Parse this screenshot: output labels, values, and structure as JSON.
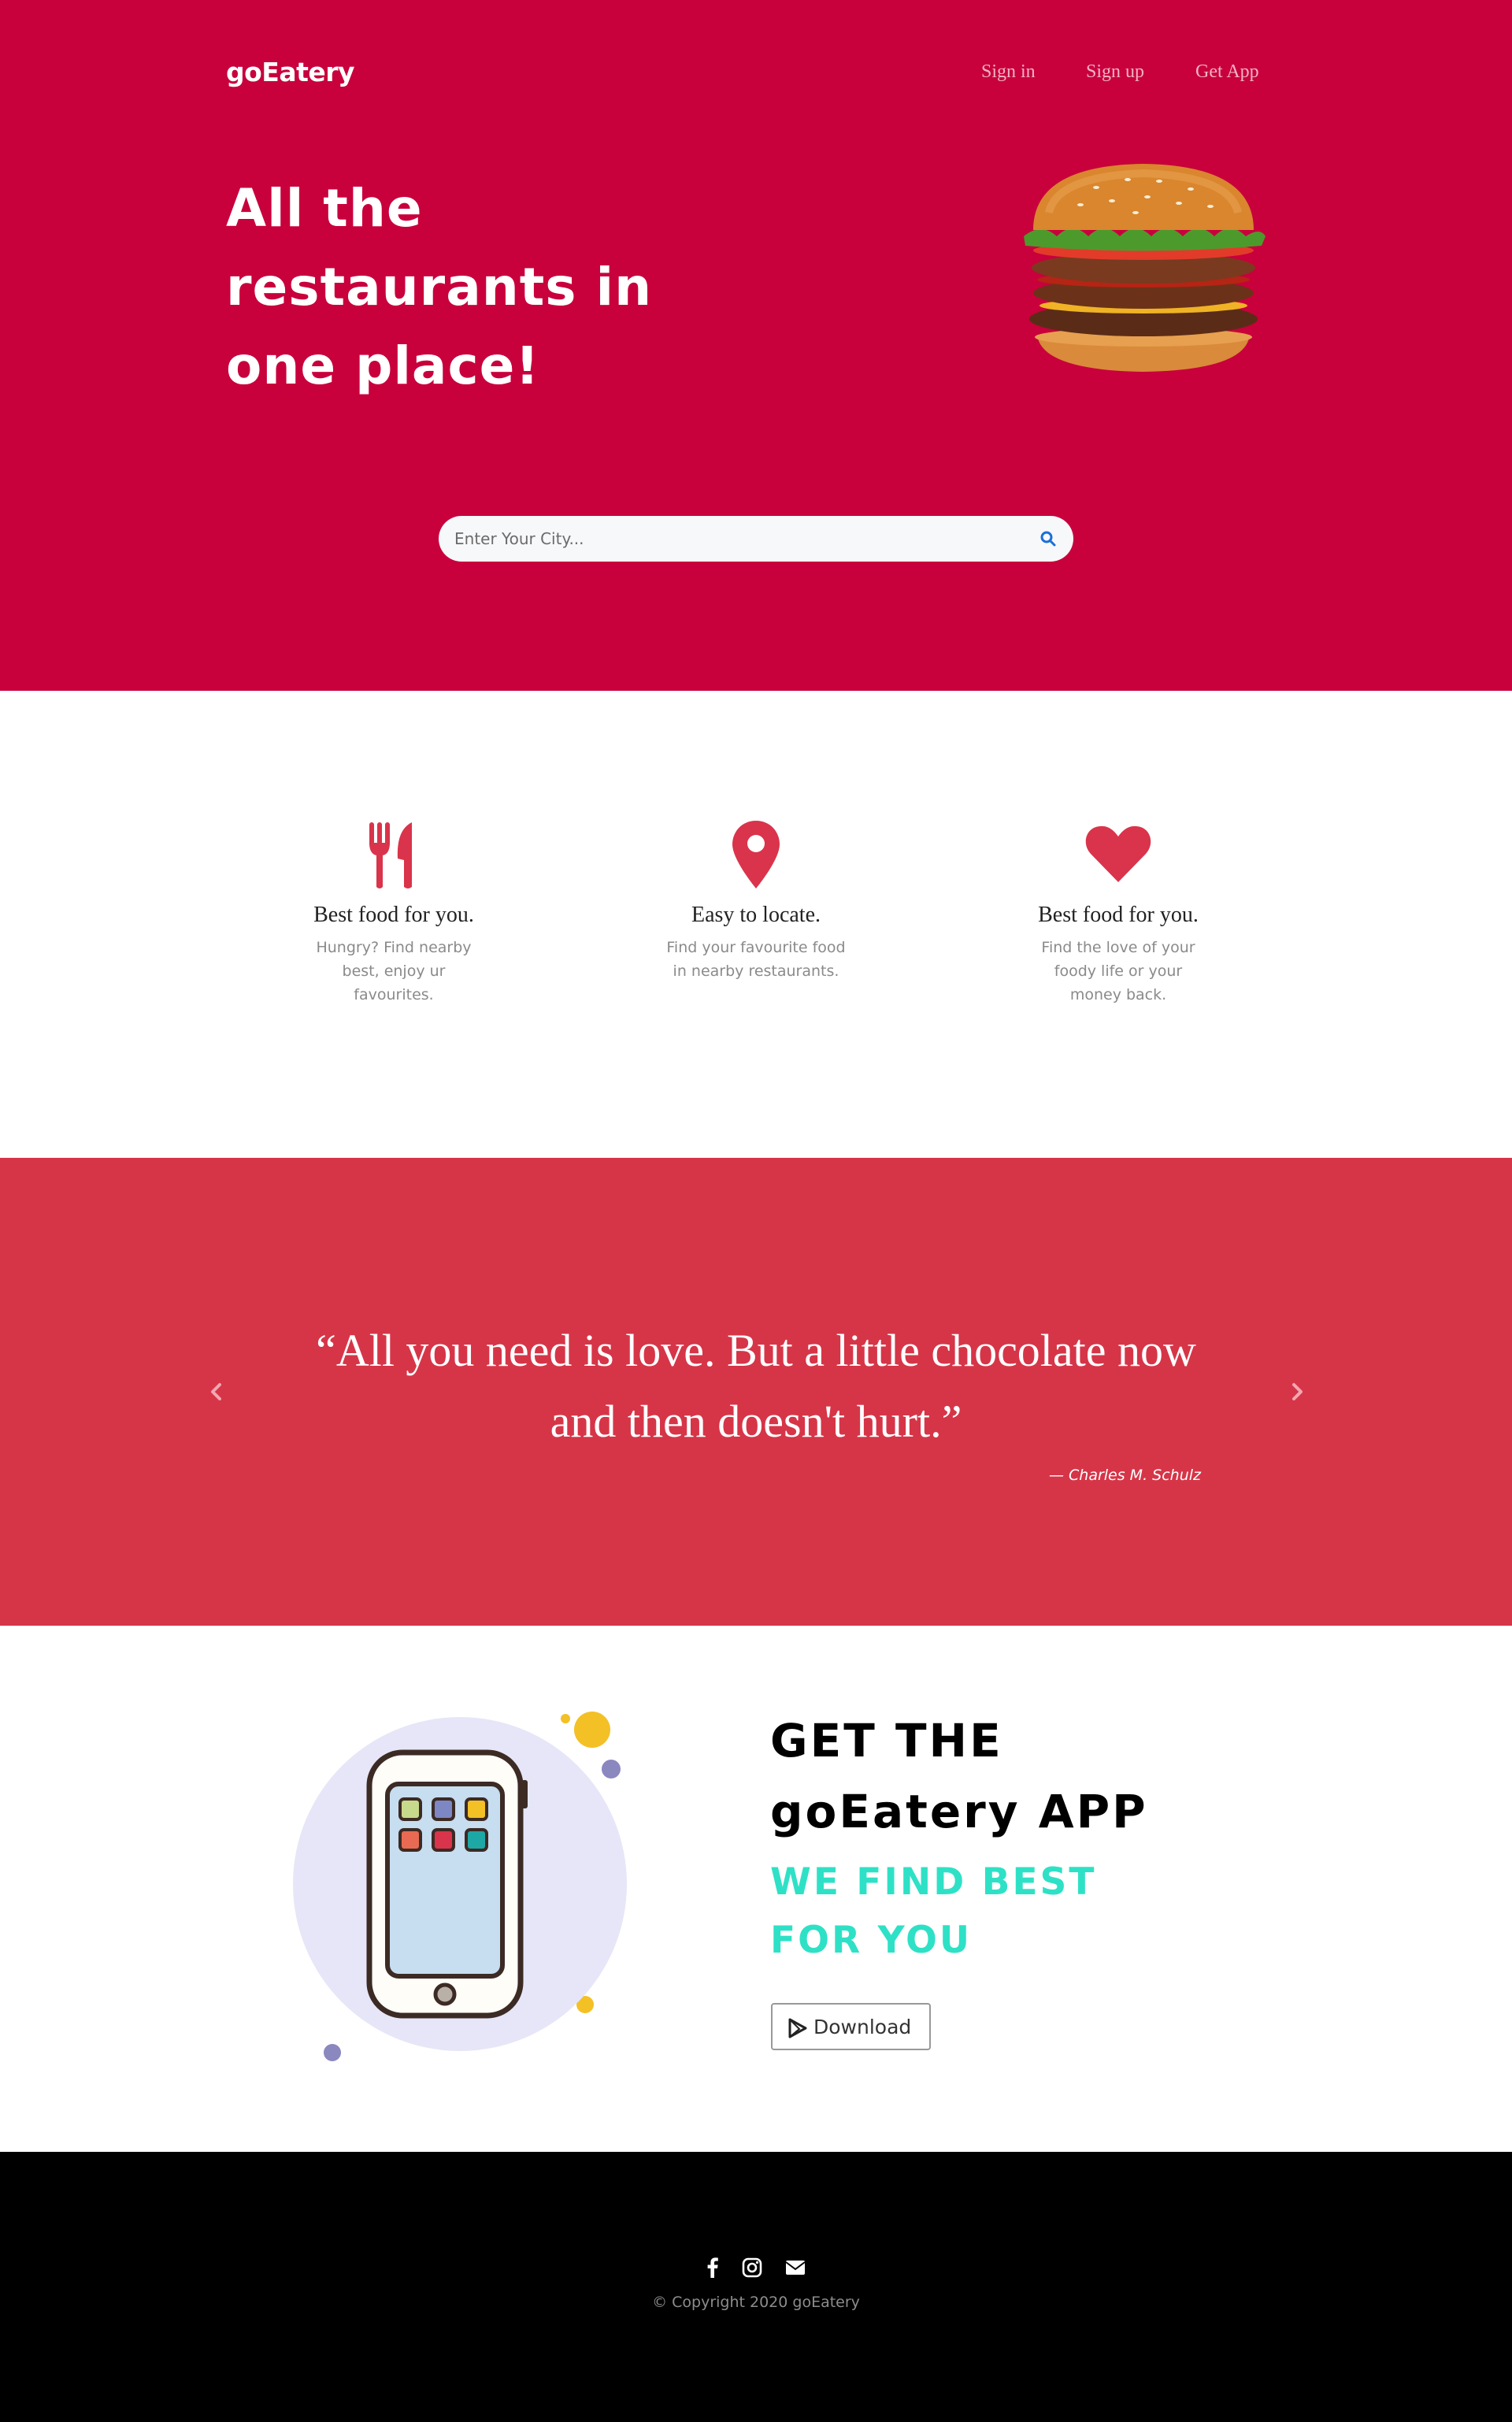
{
  "header": {
    "brand": "goEatery",
    "nav": [
      "Sign in",
      "Sign up",
      "Get App"
    ]
  },
  "hero": {
    "headline_lines": [
      "All the",
      "restaurants in",
      "one place!"
    ],
    "search_placeholder": "Enter Your City..."
  },
  "features": [
    {
      "icon": "fork-knife-icon",
      "title": "Best food for you.",
      "text": "Hungry? Find nearby best, enjoy ur favourites."
    },
    {
      "icon": "location-pin-icon",
      "title": "Easy to locate.",
      "text": "Find your favourite food in nearby restaurants."
    },
    {
      "icon": "heart-icon",
      "title": "Best food for you.",
      "text": "Find the love of your foody life or your money back."
    }
  ],
  "testimonial": {
    "quote": "“All you need is love. But a little chocolate now and then doesn't hurt.”",
    "author": "— Charles M. Schulz"
  },
  "app": {
    "title_lines": [
      "GET THE",
      "goEatery APP"
    ],
    "subtitle_lines": [
      "WE FIND BEST",
      "FOR YOU"
    ],
    "download_label": "Download"
  },
  "footer": {
    "copyright": "© Copyright 2020 goEatery"
  },
  "colors": {
    "hero_bg": "#c8003c",
    "quote_bg": "#d63548",
    "accent_icon": "#d9344b",
    "teal": "#2ee1c6",
    "footer_bg": "#000000"
  }
}
